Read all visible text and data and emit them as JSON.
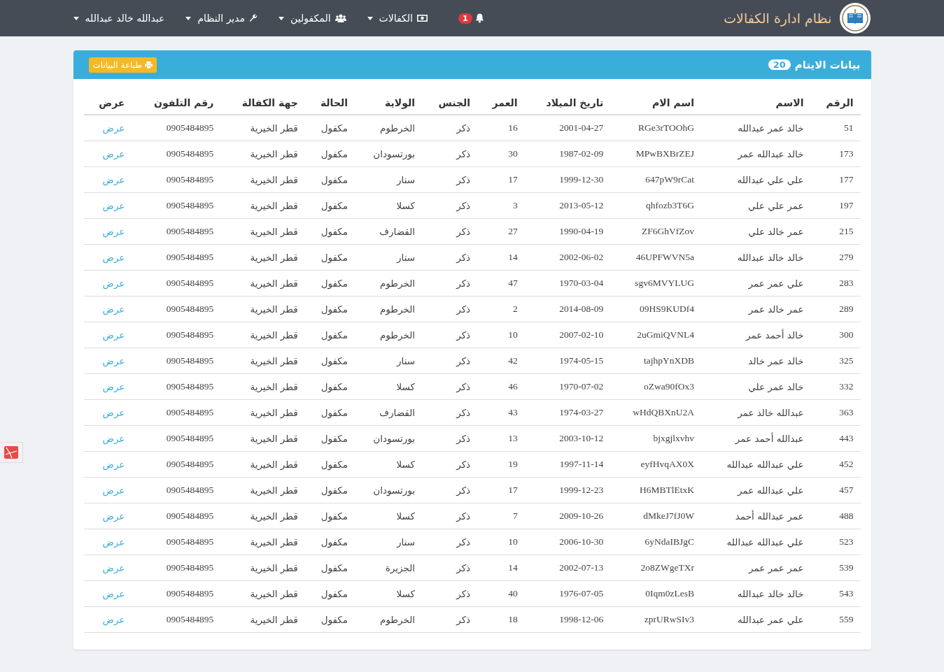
{
  "navbar": {
    "brand": "نظام ادارة الكفالات",
    "notifications": {
      "count": "1"
    },
    "menus": [
      {
        "kind": "money",
        "label": "الكفالات"
      },
      {
        "kind": "users",
        "label": "المكفولين"
      },
      {
        "kind": "wrench",
        "label": "مدير النظام"
      },
      {
        "kind": "none",
        "label": "عبدالله خالد عبدالله"
      }
    ]
  },
  "panel": {
    "title": "بيانات الايتام",
    "count": "20",
    "print_button": "طباعة البيانات"
  },
  "table": {
    "columns": [
      "الرقم",
      "الاسم",
      "اسم الام",
      "تاريخ الميلاد",
      "العمر",
      "الجنس",
      "الولاية",
      "الحالة",
      "جهة الكفالة",
      "رقم التلفون",
      "عرض"
    ],
    "rows": [
      [
        "51",
        "خالد عمر عبدالله",
        "RGe3rTOOhG",
        "2001-04-27",
        "16",
        "ذكر",
        "الخرطوم",
        "مكفول",
        "قطر الخيرية",
        "0905484895",
        "عرض"
      ],
      [
        "173",
        "خالد عبدالله عمر",
        "MPwBXBrZEJ",
        "1987-02-09",
        "30",
        "ذكر",
        "بورتسودان",
        "مكفول",
        "قطر الخيرية",
        "0905484895",
        "عرض"
      ],
      [
        "177",
        "علي علي عبدالله",
        "647pW9rCat",
        "1999-12-30",
        "17",
        "ذكر",
        "سنار",
        "مكفول",
        "قطر الخيرية",
        "0905484895",
        "عرض"
      ],
      [
        "197",
        "عمر علي علي",
        "qhfozb3T6G",
        "2013-05-12",
        "3",
        "ذكر",
        "كسلا",
        "مكفول",
        "قطر الخيرية",
        "0905484895",
        "عرض"
      ],
      [
        "215",
        "عمر خالد علي",
        "ZF6GhVfZov",
        "1990-04-19",
        "27",
        "ذكر",
        "القضارف",
        "مكفول",
        "قطر الخيرية",
        "0905484895",
        "عرض"
      ],
      [
        "279",
        "خالد خالد عبدالله",
        "46UPFWVN5a",
        "2002-06-02",
        "14",
        "ذكر",
        "سنار",
        "مكفول",
        "قطر الخيرية",
        "0905484895",
        "عرض"
      ],
      [
        "283",
        "علي عمر عمر",
        "sgv6MVYLUG",
        "1970-03-04",
        "47",
        "ذكر",
        "الخرطوم",
        "مكفول",
        "قطر الخيرية",
        "0905484895",
        "عرض"
      ],
      [
        "289",
        "عمر خالد عمر",
        "09HS9KUDf4",
        "2014-08-09",
        "2",
        "ذكر",
        "الخرطوم",
        "مكفول",
        "قطر الخيرية",
        "0905484895",
        "عرض"
      ],
      [
        "300",
        "خالد أحمد عمر",
        "2uGmiQVNL4",
        "2007-02-10",
        "10",
        "ذكر",
        "الخرطوم",
        "مكفول",
        "قطر الخيرية",
        "0905484895",
        "عرض"
      ],
      [
        "325",
        "خالد عمر خالد",
        "tajhpYnXDB",
        "1974-05-15",
        "42",
        "ذكر",
        "سنار",
        "مكفول",
        "قطر الخيرية",
        "0905484895",
        "عرض"
      ],
      [
        "332",
        "خالد عمر علي",
        "oZwa90fOx3",
        "1970-07-02",
        "46",
        "ذكر",
        "كسلا",
        "مكفول",
        "قطر الخيرية",
        "0905484895",
        "عرض"
      ],
      [
        "363",
        "عبدالله خالد عمر",
        "wHdQBXnU2A",
        "1974-03-27",
        "43",
        "ذكر",
        "القضارف",
        "مكفول",
        "قطر الخيرية",
        "0905484895",
        "عرض"
      ],
      [
        "443",
        "عبدالله أحمد عمر",
        "bjxgjlxvhv",
        "2003-10-12",
        "13",
        "ذكر",
        "بورتسودان",
        "مكفول",
        "قطر الخيرية",
        "0905484895",
        "عرض"
      ],
      [
        "452",
        "علي عبدالله عبدالله",
        "eyfHvqAX0X",
        "1997-11-14",
        "19",
        "ذكر",
        "كسلا",
        "مكفول",
        "قطر الخيرية",
        "0905484895",
        "عرض"
      ],
      [
        "457",
        "علي عبدالله عمر",
        "H6MBTlEtxK",
        "1999-12-23",
        "17",
        "ذكر",
        "بورتسودان",
        "مكفول",
        "قطر الخيرية",
        "0905484895",
        "عرض"
      ],
      [
        "488",
        "عمر عبدالله أحمد",
        "dMkeJ7fJ0W",
        "2009-10-26",
        "7",
        "ذكر",
        "كسلا",
        "مكفول",
        "قطر الخيرية",
        "0905484895",
        "عرض"
      ],
      [
        "523",
        "علي عبدالله عبدالله",
        "6yNdaIBJgC",
        "2006-10-30",
        "10",
        "ذكر",
        "سنار",
        "مكفول",
        "قطر الخيرية",
        "0905484895",
        "عرض"
      ],
      [
        "539",
        "عمر عمر عمر",
        "2o8ZWgeTXr",
        "2002-07-13",
        "14",
        "ذكر",
        "الجزيرة",
        "مكفول",
        "قطر الخيرية",
        "0905484895",
        "عرض"
      ],
      [
        "543",
        "خالد خالد عبدالله",
        "0Iqm0zLesB",
        "1976-07-05",
        "40",
        "ذكر",
        "كسلا",
        "مكفول",
        "قطر الخيرية",
        "0905484895",
        "عرض"
      ],
      [
        "559",
        "علي عمر عبدالله",
        "zprURwSIv3",
        "1998-12-06",
        "18",
        "ذكر",
        "الخرطوم",
        "مكفول",
        "قطر الخيرية",
        "0905484895",
        "عرض"
      ]
    ]
  }
}
